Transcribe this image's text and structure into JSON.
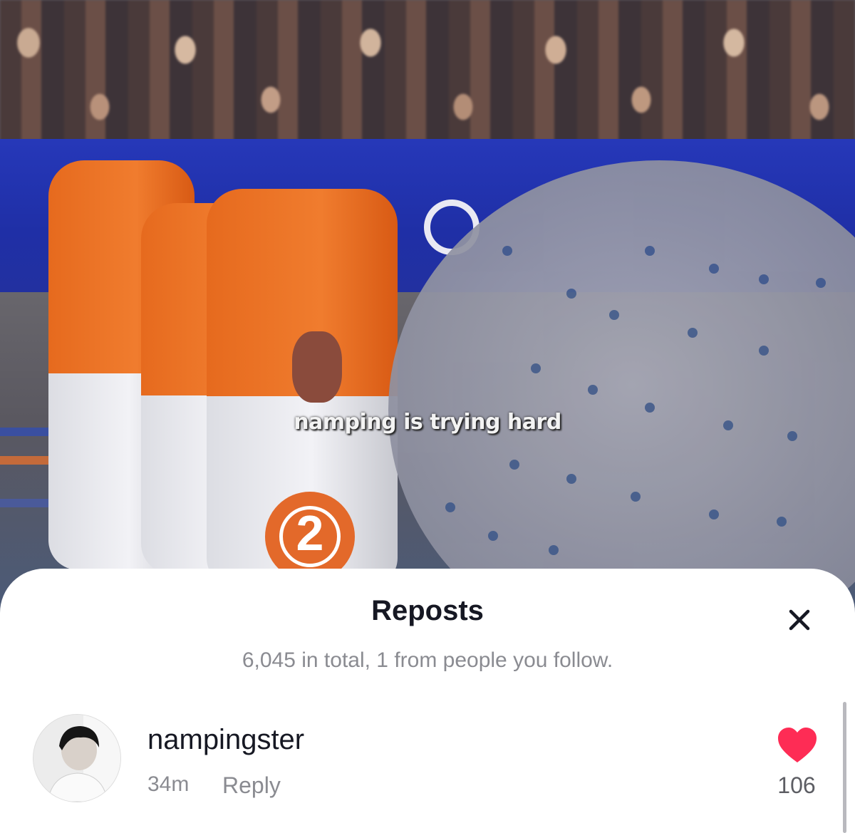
{
  "video": {
    "caption": "namping is trying hard",
    "pin_number": "2"
  },
  "sheet": {
    "title": "Reposts",
    "subtitle": "6,045 in total, 1 from people you follow.",
    "close_icon": "close-icon"
  },
  "reposts": [
    {
      "username": "nampingster",
      "time": "34m",
      "reply_label": "Reply",
      "likes": "106",
      "liked": true,
      "like_color": "#fe2c55"
    }
  ]
}
